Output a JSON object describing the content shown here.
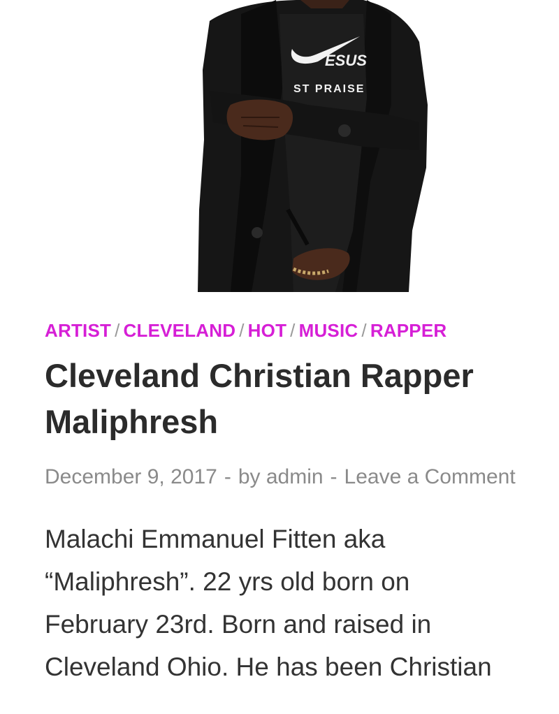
{
  "hero_image": {
    "shirt_text_line1": "ESUS",
    "shirt_text_line2": "ST PRAISE"
  },
  "post": {
    "categories": [
      {
        "label": "ARTIST"
      },
      {
        "label": "CLEVELAND"
      },
      {
        "label": "HOT"
      },
      {
        "label": "MUSIC"
      },
      {
        "label": "RAPPER"
      }
    ],
    "category_separator": "/",
    "title": "Cleveland Christian Rapper Maliphresh",
    "date": "December 9, 2017",
    "meta_separator": "-",
    "author": "by admin",
    "comment_link": "Leave a Comment",
    "body_text": "Malachi Emmanuel Fitten aka “Maliphresh”. 22 yrs old born on February 23rd. Born and raised in Cleveland Ohio. He has been Christian"
  },
  "colors": {
    "category": "#d61fd6",
    "title": "#2b2b2b",
    "meta": "#8a8a8a",
    "body": "#333333"
  }
}
